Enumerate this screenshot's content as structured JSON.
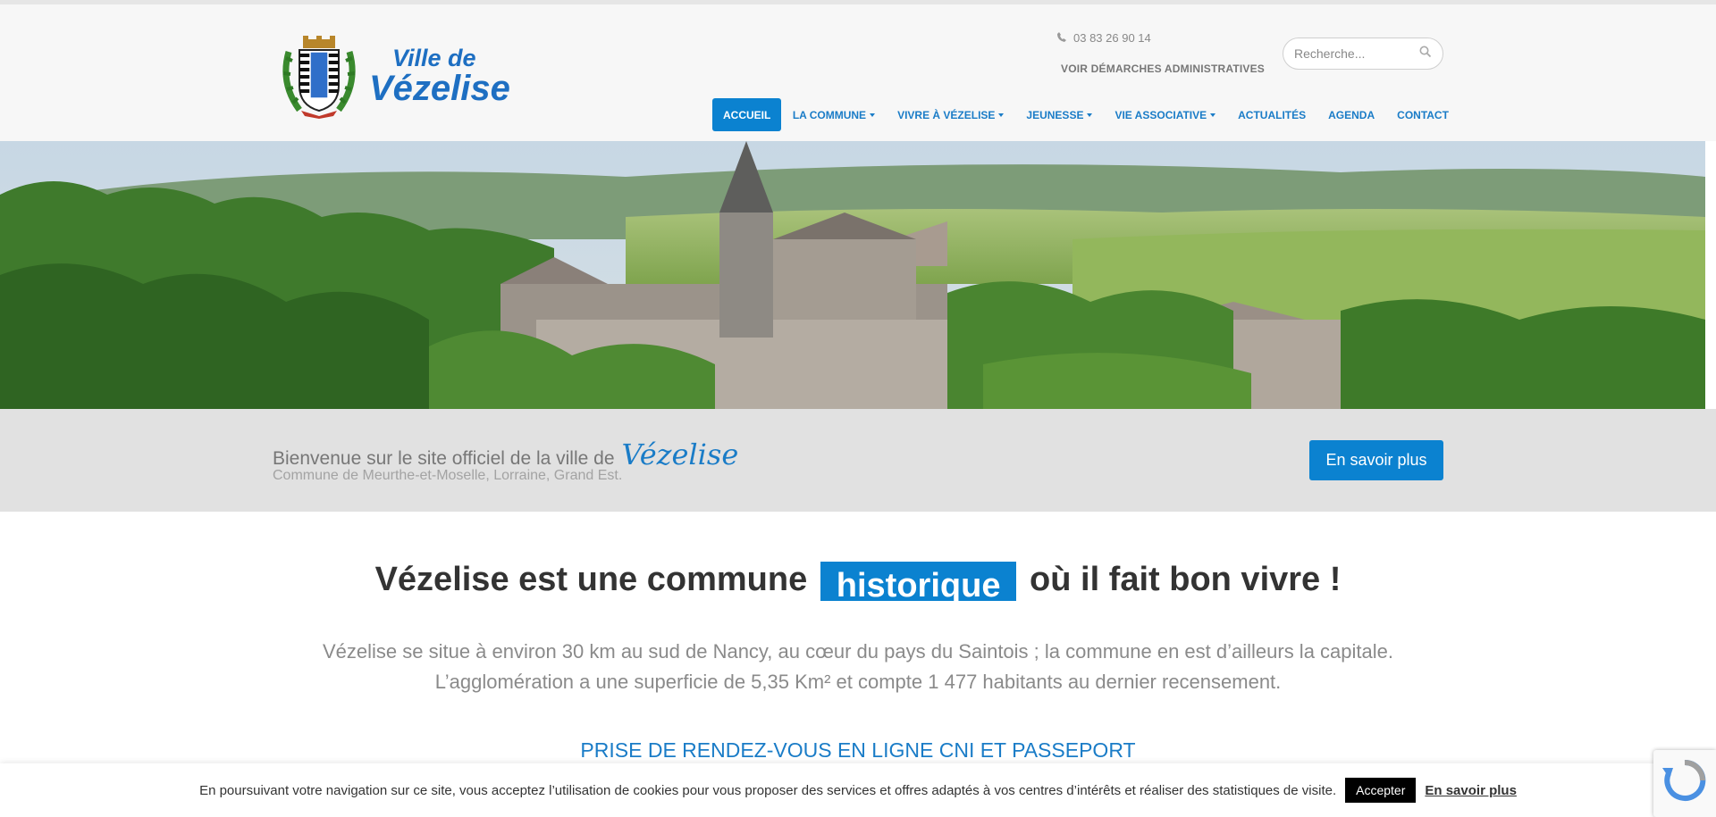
{
  "header": {
    "logo_line1": "Ville de",
    "logo_line2": "Vézelise",
    "phone": "03 83 26 90 14",
    "demarches_link": "VOIR DÉMARCHES ADMINISTRATIVES",
    "search_placeholder": "Recherche..."
  },
  "nav": {
    "items": [
      {
        "label": "ACCUEIL",
        "active": true
      },
      {
        "label": "LA COMMUNE",
        "dropdown": true
      },
      {
        "label": "VIVRE À VÉZELISE",
        "dropdown": true
      },
      {
        "label": "JEUNESSE",
        "dropdown": true
      },
      {
        "label": "VIE ASSOCIATIVE",
        "dropdown": true
      },
      {
        "label": "ACTUALITÉS"
      },
      {
        "label": "AGENDA"
      },
      {
        "label": "CONTACT"
      }
    ]
  },
  "welcome": {
    "title": "Bienvenue sur le site officiel de la ville de",
    "script_name": "Vézelise",
    "subtitle": "Commune de Meurthe-et-Moselle, Lorraine, Grand Est.",
    "button_label": "En savoir plus"
  },
  "main": {
    "headline_before": "Vézelise est une commune",
    "headline_highlight": "historique",
    "headline_after": "où il fait bon vivre !",
    "desc_line1": "Vézelise se situe à environ 30 km au sud de Nancy, au cœur du pays du Saintois ; la commune en est d’ailleurs la capitale.",
    "desc_line2": "L’agglomération a une superficie de 5,35 Km² et compte 1 477 habitants au dernier recensement.",
    "rdv_heading": "PRISE DE RENDEZ-VOUS EN LIGNE CNI ET PASSEPORT"
  },
  "cookie": {
    "text": "En poursuivant votre navigation sur ce site, vous acceptez l’utilisation de cookies pour vous proposer des services et offres adaptés à vos centres d’intérêts et réaliser des statistiques de visite.",
    "accept_label": "Accepter",
    "more_label": "En savoir plus"
  },
  "colors": {
    "brand_blue": "#0b82d0",
    "nav_text": "#1a7cc7",
    "welcome_band": "#e1e1e1"
  },
  "icons": [
    "phone-icon",
    "search-icon",
    "caret-down-icon",
    "recaptcha-icon"
  ]
}
